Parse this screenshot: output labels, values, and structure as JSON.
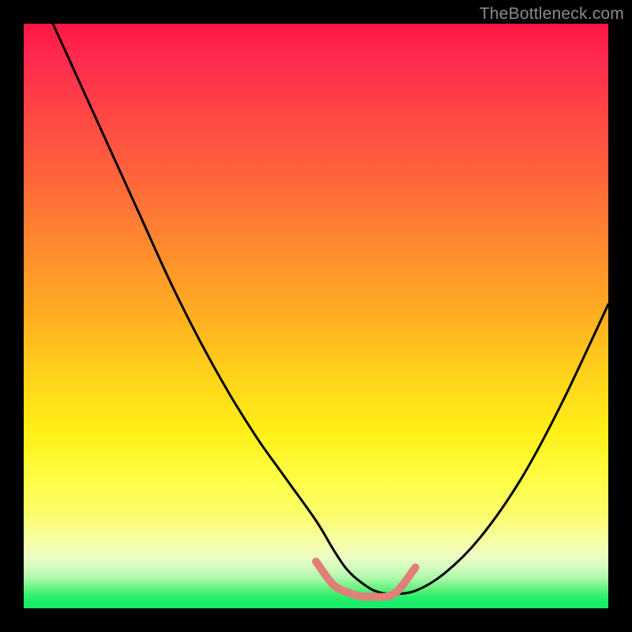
{
  "watermark": "TheBottleneck.com",
  "chart_data": {
    "type": "line",
    "title": "",
    "xlabel": "",
    "ylabel": "",
    "x_range": [
      0,
      100
    ],
    "y_range": [
      0,
      100
    ],
    "note": "Axes are unitless; values are read as percentage of plot width/height. y=100 is top, y=0 is bottom.",
    "series": [
      {
        "name": "black-curve",
        "role": "bottleneck-curve",
        "color": "#000",
        "x": [
          5,
          10,
          15,
          20,
          25,
          30,
          35,
          40,
          45,
          50,
          53,
          55,
          57,
          60,
          63,
          67,
          72,
          78,
          85,
          92,
          100
        ],
        "y": [
          100,
          89,
          78,
          67,
          56,
          46,
          37,
          29,
          22,
          15,
          10,
          7,
          5,
          3,
          2.5,
          3,
          6,
          12,
          22,
          35,
          52
        ]
      },
      {
        "name": "pink-ideal-zone",
        "role": "sweet-spot-marker",
        "color": "#e08078",
        "x": [
          50,
          53,
          56,
          58,
          60,
          62,
          64,
          67
        ],
        "y": [
          8,
          4,
          2.5,
          2,
          2,
          2,
          3,
          7
        ]
      }
    ],
    "background_gradient": {
      "top_color": "#ff1744",
      "mid_color": "#ffd21a",
      "bottom_color": "#1bec68"
    }
  }
}
